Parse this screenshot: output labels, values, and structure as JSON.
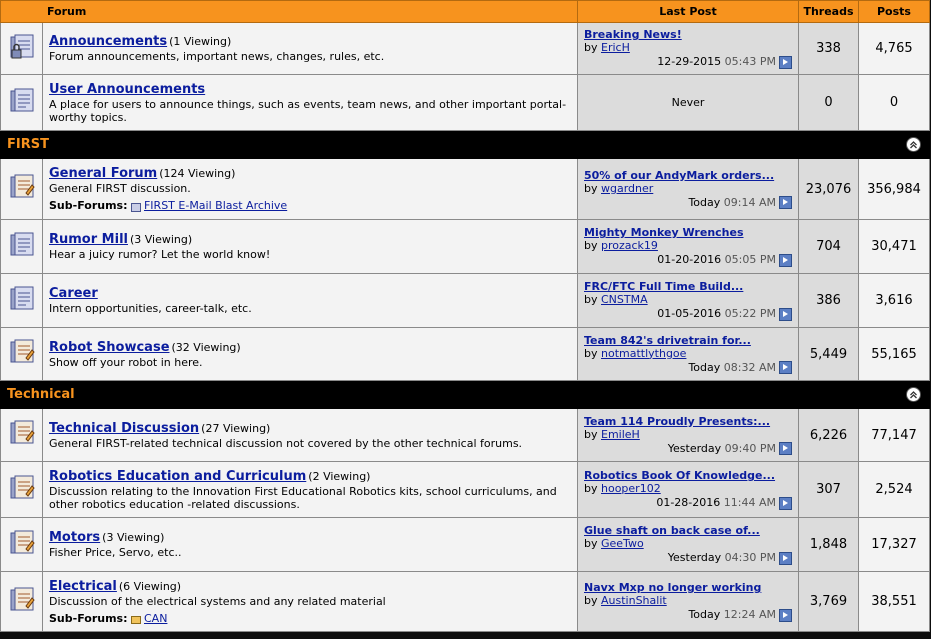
{
  "header": {
    "forum": "Forum",
    "last_post": "Last Post",
    "threads": "Threads",
    "posts": "Posts"
  },
  "sub_forums_label": "Sub-Forums:",
  "by_label": "by",
  "uncategorized": [
    {
      "title": "Announcements",
      "viewing": "(1 Viewing)",
      "desc": "Forum announcements, important news, changes, rules, etc.",
      "last_title": "Breaking News!",
      "last_by": "EricH",
      "last_date": "12-29-2015",
      "last_time": "05:43 PM",
      "threads": "338",
      "posts": "4,765",
      "locked": true
    },
    {
      "title": "User Announcements",
      "viewing": "",
      "desc": "A place for users to announce things, such as events, team news, and other important portal-worthy topics.",
      "never": "Never",
      "threads": "0",
      "posts": "0"
    }
  ],
  "categories": [
    {
      "name": "FIRST",
      "forums": [
        {
          "title": "General Forum",
          "viewing": "(124 Viewing)",
          "desc": "General FIRST discussion.",
          "subforum": "FIRST E-Mail Blast Archive",
          "last_title": "50% of our AndyMark orders...",
          "last_by": "wgardner",
          "last_date": "Today",
          "last_time": "09:14 AM",
          "threads": "23,076",
          "posts": "356,984"
        },
        {
          "title": "Rumor Mill",
          "viewing": "(3 Viewing)",
          "desc": "Hear a juicy rumor? Let the world know!",
          "last_title": "Mighty Monkey Wrenches",
          "last_by": "prozack19",
          "last_date": "01-20-2016",
          "last_time": "05:05 PM",
          "threads": "704",
          "posts": "30,471"
        },
        {
          "title": "Career",
          "viewing": "",
          "desc": "Intern opportunities, career-talk, etc.",
          "last_title": "FRC/FTC Full Time Build...",
          "last_by": "CNSTMA",
          "last_date": "01-05-2016",
          "last_time": "05:22 PM",
          "threads": "386",
          "posts": "3,616"
        },
        {
          "title": "Robot Showcase",
          "viewing": "(32 Viewing)",
          "desc": "Show off your robot in here.",
          "last_title": "Team 842's drivetrain for...",
          "last_by": "notmattlythgoe",
          "last_date": "Today",
          "last_time": "08:32 AM",
          "threads": "5,449",
          "posts": "55,165"
        }
      ]
    },
    {
      "name": "Technical",
      "forums": [
        {
          "title": "Technical Discussion",
          "viewing": "(27 Viewing)",
          "desc": "General FIRST-related technical discussion not covered by the other technical forums.",
          "last_title": "Team 114 Proudly Presents:...",
          "last_by": "EmileH",
          "last_date": "Yesterday",
          "last_time": "09:40 PM",
          "threads": "6,226",
          "posts": "77,147"
        },
        {
          "title": "Robotics Education and Curriculum",
          "viewing": "(2 Viewing)",
          "desc": "Discussion relating to the Innovation First Educational Robotics kits, school curriculums, and other robotics education -related discussions.",
          "last_title": "Robotics Book Of Knowledge...",
          "last_by": "hooper102",
          "last_date": "01-28-2016",
          "last_time": "11:44 AM",
          "threads": "307",
          "posts": "2,524"
        },
        {
          "title": "Motors",
          "viewing": "(3 Viewing)",
          "desc": "Fisher Price, Servo, etc..",
          "last_title": "Glue shaft on back case of...",
          "last_by": "GeeTwo",
          "last_date": "Yesterday",
          "last_time": "04:30 PM",
          "threads": "1,848",
          "posts": "17,327"
        },
        {
          "title": "Electrical",
          "viewing": "(6 Viewing)",
          "desc": "Discussion of the electrical systems and any related material",
          "subforum": "CAN",
          "last_title": "Navx Mxp no longer working",
          "last_by": "AustinShalit",
          "last_date": "Today",
          "last_time": "12:24 AM",
          "threads": "3,769",
          "posts": "38,551"
        }
      ]
    }
  ]
}
